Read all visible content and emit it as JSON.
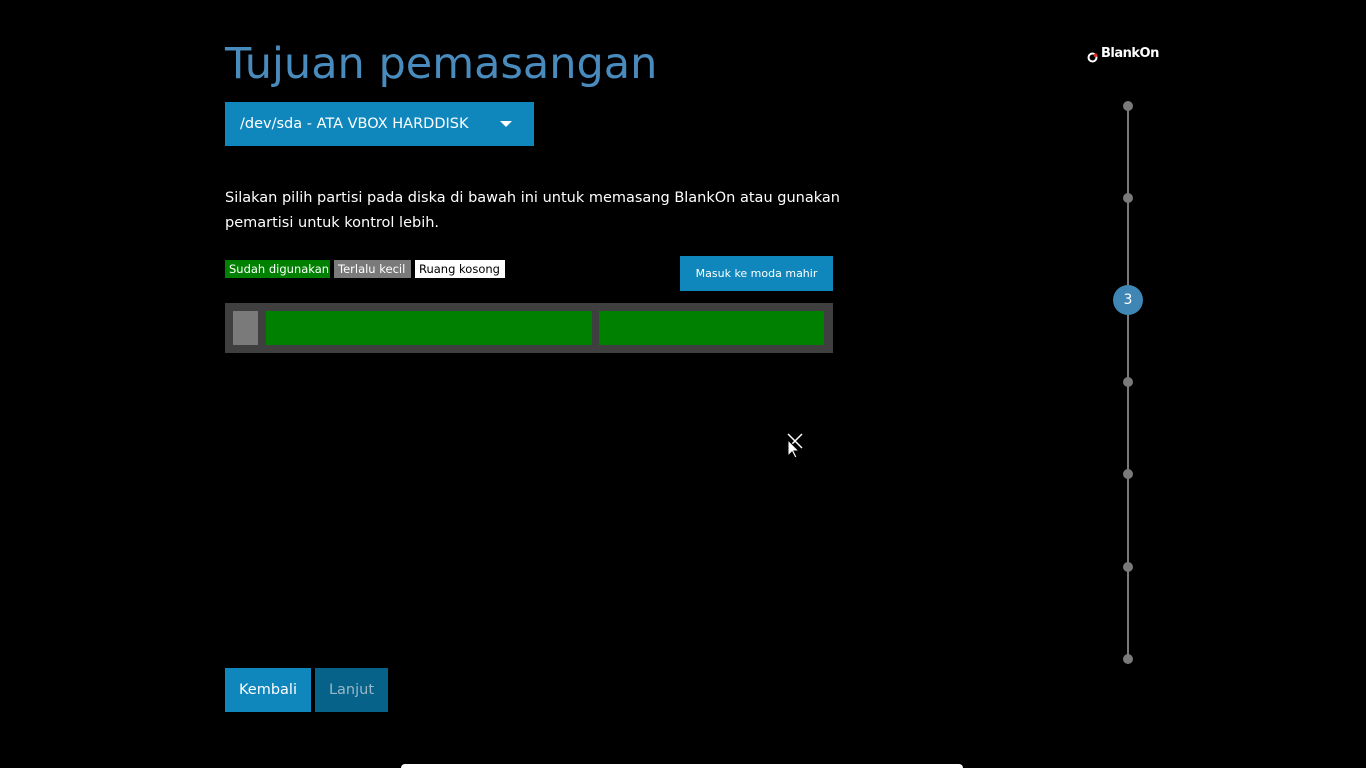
{
  "header": {
    "title": "Tujuan pemasangan",
    "brand_name": "BlankOn"
  },
  "disk_select": {
    "selected": "/dev/sda - ATA VBOX HARDDISK"
  },
  "description": "Silakan pilih partisi pada diska di bawah ini untuk memasang BlankOn atau gunakan pemartisi untuk kontrol lebih.",
  "legend": {
    "used": "Sudah digunakan",
    "too_small": "Terlalu kecil",
    "free_space": "Ruang kosong"
  },
  "advanced_button": "Masuk ke moda mahir",
  "partitions": [
    {
      "type": "too_small"
    },
    {
      "type": "used"
    },
    {
      "type": "used"
    }
  ],
  "navigation": {
    "back": "Kembali",
    "next": "Lanjut"
  },
  "progress": {
    "current_step": "3",
    "total_steps": 7
  },
  "colors": {
    "accent": "#0f87bd",
    "title": "#4a8bbd",
    "used": "#008000",
    "too_small": "#7a7a7a",
    "free": "#ffffff",
    "background": "#000000"
  }
}
